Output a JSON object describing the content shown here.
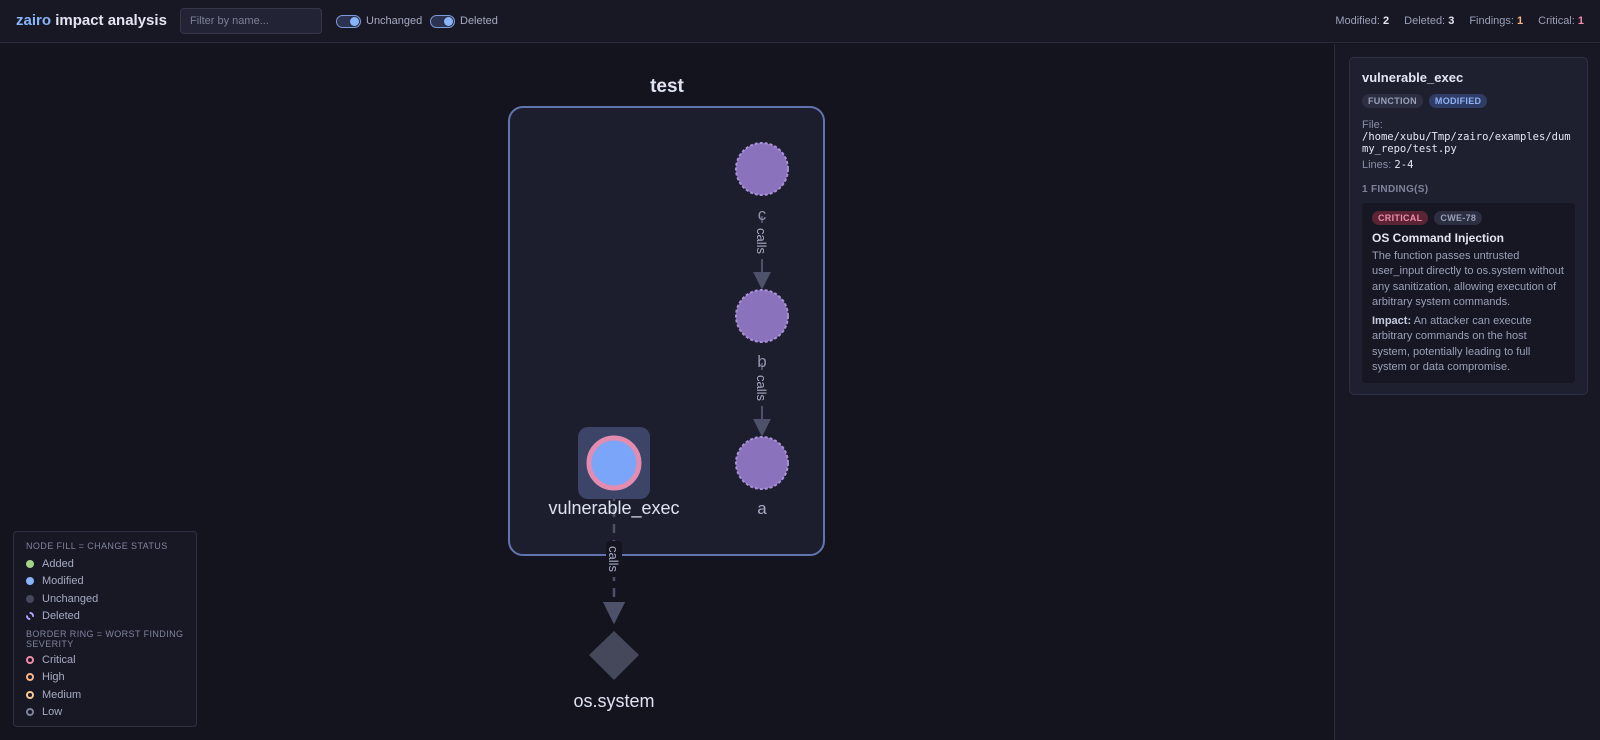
{
  "header": {
    "brand_accent": "zairo",
    "brand_rest": "impact analysis",
    "search_placeholder": "Filter by name...",
    "toggle_unchanged": "Unchanged",
    "toggle_deleted": "Deleted",
    "stats": {
      "modified_label": "Modified:",
      "modified": "2",
      "deleted_label": "Deleted:",
      "deleted": "3",
      "findings_label": "Findings:",
      "findings": "1",
      "critical_label": "Critical:",
      "critical": "1"
    }
  },
  "graph": {
    "group_label": "test",
    "nodes": {
      "c": "c",
      "b": "b",
      "a": "a",
      "vulnerable_exec": "vulnerable_exec",
      "os_system": "os.system"
    },
    "edge_label": "calls"
  },
  "legend": {
    "fill_title": "NODE FILL = CHANGE STATUS",
    "fill_items": [
      {
        "label": "Added",
        "color": "#a6d189"
      },
      {
        "label": "Modified",
        "color": "#89b4fa"
      },
      {
        "label": "Unchanged",
        "color": "#45475a"
      },
      {
        "label": "Deleted",
        "color": "#b4a0ff"
      }
    ],
    "ring_title": "BORDER RING = WORST FINDING SEVERITY",
    "ring_items": [
      {
        "label": "Critical",
        "color": "#f38ba8"
      },
      {
        "label": "High",
        "color": "#fab387"
      },
      {
        "label": "Medium",
        "color": "#f9c98f"
      },
      {
        "label": "Low",
        "color": "#7f849c"
      }
    ]
  },
  "details": {
    "title": "vulnerable_exec",
    "type_badge": "FUNCTION",
    "status_badge": "MODIFIED",
    "file_label": "File:",
    "file_path": "/home/xubu/Tmp/zairo/examples/dummy_repo/test.py",
    "lines_label": "Lines:",
    "lines_value": "2-4",
    "findings_header": "1 FINDING(S)",
    "finding": {
      "severity": "CRITICAL",
      "cwe": "CWE-78",
      "title": "OS Command Injection",
      "description": "The function passes untrusted user_input directly to os.system without any sanitization, allowing execution of arbitrary system commands.",
      "impact_label": "Impact:",
      "impact_text": "An attacker can execute arbitrary commands on the host system, potentially leading to full system or data compromise."
    }
  },
  "colors": {
    "background": "#14141f",
    "deleted_node": "#8b72bd",
    "modified_node": "#7aa5f8",
    "critical_ring": "#e48cb0",
    "external_node": "#45475a",
    "group_border": "#6274b0"
  }
}
